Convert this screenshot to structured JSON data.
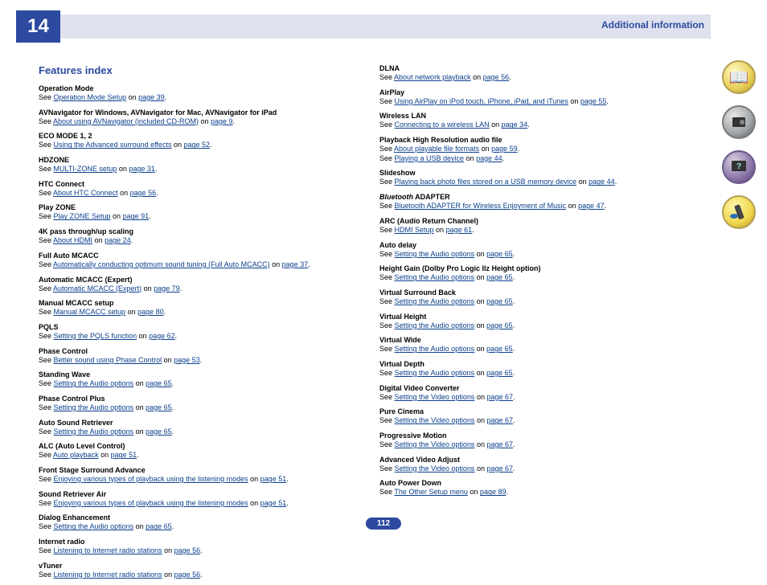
{
  "chapterNumber": "14",
  "chapterTitle": "Additional information",
  "pageNumber": "112",
  "heading": "Features index",
  "col1": [
    {
      "title": "Operation Mode",
      "lines": [
        {
          "pre": "See ",
          "link": "Operation Mode Setup",
          "on": " on ",
          "page": "page 39"
        }
      ]
    },
    {
      "title": "AVNavigator for Windows, AVNavigator for Mac, AVNavigator for iPad",
      "lines": [
        {
          "pre": "See ",
          "link": "About using AVNavigator (included CD-ROM)",
          "on": " on ",
          "page": "page 9"
        }
      ]
    },
    {
      "title": "ECO MODE 1, 2",
      "lines": [
        {
          "pre": "See ",
          "link": "Using the Advanced surround effects",
          "on": " on ",
          "page": "page 52"
        }
      ]
    },
    {
      "title": "HDZONE",
      "lines": [
        {
          "pre": "See ",
          "link": "MULTI-ZONE setup",
          "on": " on ",
          "page": "page 31"
        }
      ]
    },
    {
      "title": "HTC Connect",
      "lines": [
        {
          "pre": "See ",
          "link": "About HTC Connect",
          "on": " on ",
          "page": "page 56"
        }
      ]
    },
    {
      "title": "Play ZONE",
      "lines": [
        {
          "pre": "See ",
          "link": "Play ZONE Setup",
          "on": " on ",
          "page": "page 91"
        }
      ]
    },
    {
      "title": "4K pass through/up scaling",
      "lines": [
        {
          "pre": "See ",
          "link": "About HDMI",
          "on": " on ",
          "page": "page 24"
        }
      ]
    },
    {
      "title": "Full Auto MCACC",
      "lines": [
        {
          "pre": "See ",
          "link": "Automatically conducting optimum sound tuning (Full Auto MCACC)",
          "on": " on ",
          "page": "page 37"
        }
      ]
    },
    {
      "title": "Automatic MCACC (Expert)",
      "lines": [
        {
          "pre": "See ",
          "link": "Automatic MCACC (Expert)",
          "on": " on ",
          "page": "page 79"
        }
      ]
    },
    {
      "title": "Manual MCACC setup",
      "lines": [
        {
          "pre": "See ",
          "link": "Manual MCACC setup",
          "on": " on ",
          "page": "page 80"
        }
      ]
    },
    {
      "title": "PQLS",
      "lines": [
        {
          "pre": "See ",
          "link": "Setting the PQLS function",
          "on": " on ",
          "page": "page 62"
        }
      ]
    },
    {
      "title": "Phase Control",
      "lines": [
        {
          "pre": "See ",
          "link": "Better sound using Phase Control",
          "on": " on ",
          "page": "page 53"
        }
      ]
    },
    {
      "title": "Standing Wave",
      "lines": [
        {
          "pre": "See ",
          "link": "Setting the Audio options",
          "on": " on ",
          "page": "page 65"
        }
      ]
    },
    {
      "title": "Phase Control Plus",
      "lines": [
        {
          "pre": "See ",
          "link": "Setting the Audio options",
          "on": " on ",
          "page": "page 65"
        }
      ]
    },
    {
      "title": "Auto Sound Retriever",
      "lines": [
        {
          "pre": "See ",
          "link": "Setting the Audio options",
          "on": " on ",
          "page": "page 65"
        }
      ]
    },
    {
      "title": "ALC (Auto Level Control)",
      "lines": [
        {
          "pre": "See ",
          "link": "Auto playback",
          "on": " on ",
          "page": "page 51"
        }
      ]
    },
    {
      "title": "Front Stage Surround Advance",
      "lines": [
        {
          "pre": "See ",
          "link": "Enjoying various types of playback using the listening modes",
          "on": " on ",
          "page": "page 51"
        }
      ]
    },
    {
      "title": "Sound Retriever Air",
      "lines": [
        {
          "pre": "See ",
          "link": "Enjoying various types of playback using the listening modes",
          "on": " on ",
          "page": "page 51"
        }
      ]
    },
    {
      "title": "Dialog Enhancement",
      "lines": [
        {
          "pre": "See ",
          "link": "Setting the Audio options",
          "on": " on ",
          "page": "page 65"
        }
      ]
    },
    {
      "title": "Internet radio",
      "lines": [
        {
          "pre": "See ",
          "link": "Listening to Internet radio stations",
          "on": " on ",
          "page": "page 56"
        }
      ]
    },
    {
      "title": "vTuner",
      "lines": [
        {
          "pre": "See ",
          "link": "Listening to Internet radio stations",
          "on": " on ",
          "page": "page 56"
        }
      ]
    }
  ],
  "col2": [
    {
      "title": "DLNA",
      "lines": [
        {
          "pre": "See ",
          "link": "About network playback",
          "on": " on ",
          "page": "page 56"
        }
      ]
    },
    {
      "title": "AirPlay",
      "lines": [
        {
          "pre": "See ",
          "link": "Using AirPlay on iPod touch, iPhone, iPad, and iTunes",
          "on": " on ",
          "page": "page 55"
        }
      ]
    },
    {
      "title": "Wireless LAN",
      "lines": [
        {
          "pre": "See ",
          "link": "Connecting to a wireless LAN",
          "on": " on ",
          "page": "page 34"
        }
      ]
    },
    {
      "title": "Playback High Resolution audio file",
      "lines": [
        {
          "pre": "See ",
          "link": "About playable file formats",
          "on": " on ",
          "page": "page 59"
        },
        {
          "pre": "See ",
          "link": "Playing a USB device",
          "on": " on ",
          "page": "page 44"
        }
      ]
    },
    {
      "title": "Slideshow",
      "lines": [
        {
          "pre": "See ",
          "link": "Playing back photo files stored on a USB memory device",
          "on": " on ",
          "page": "page 44"
        }
      ]
    },
    {
      "titleRich": [
        {
          "t": "Bluetooth",
          "i": true
        },
        {
          "t": " ADAPTER",
          "i": false
        }
      ],
      "lines": [
        {
          "pre": "See ",
          "link": "Bluetooth ADAPTER for Wireless Enjoyment of Music",
          "on": " on ",
          "page": "page 47"
        }
      ]
    },
    {
      "title": "ARC (Audio Return Channel)",
      "lines": [
        {
          "pre": "See ",
          "link": "HDMI Setup",
          "on": " on ",
          "page": "page 61"
        }
      ]
    },
    {
      "title": "Auto delay",
      "lines": [
        {
          "pre": "See ",
          "link": "Setting the Audio options",
          "on": " on ",
          "page": "page 65"
        }
      ]
    },
    {
      "title": "Height Gain (Dolby Pro Logic llz Height option)",
      "lines": [
        {
          "pre": "See ",
          "link": "Setting the Audio options",
          "on": " on ",
          "page": "page 65"
        }
      ]
    },
    {
      "title": "Virtual Surround Back",
      "lines": [
        {
          "pre": "See ",
          "link": "Setting the Audio options",
          "on": " on ",
          "page": "page 65"
        }
      ]
    },
    {
      "title": "Virtual Height",
      "lines": [
        {
          "pre": "See ",
          "link": "Setting the Audio options",
          "on": " on ",
          "page": "page 65"
        }
      ]
    },
    {
      "title": "Virtual Wide",
      "lines": [
        {
          "pre": "See ",
          "link": "Setting the Audio options",
          "on": " on ",
          "page": "page 65"
        }
      ]
    },
    {
      "title": "Virtual Depth",
      "lines": [
        {
          "pre": "See ",
          "link": "Setting the Audio options",
          "on": " on ",
          "page": "page 65"
        }
      ]
    },
    {
      "title": "Digital Video Converter",
      "lines": [
        {
          "pre": "See ",
          "link": "Setting the Video options",
          "on": " on ",
          "page": "page 67"
        }
      ]
    },
    {
      "title": "Pure Cinema",
      "lines": [
        {
          "pre": "See ",
          "link": "Setting the Video options",
          "on": " on ",
          "page": "page 67"
        }
      ]
    },
    {
      "title": "Progressive Motion",
      "lines": [
        {
          "pre": "See ",
          "link": "Setting the Video options",
          "on": " on ",
          "page": "page 67"
        }
      ]
    },
    {
      "title": "Advanced Video Adjust",
      "lines": [
        {
          "pre": "See ",
          "link": "Setting the Video options",
          "on": " on ",
          "page": "page 67"
        }
      ]
    },
    {
      "title": "Auto Power Down",
      "lines": [
        {
          "pre": "See ",
          "link": "The Other Setup menu",
          "on": " on ",
          "page": "page 89"
        }
      ]
    }
  ]
}
